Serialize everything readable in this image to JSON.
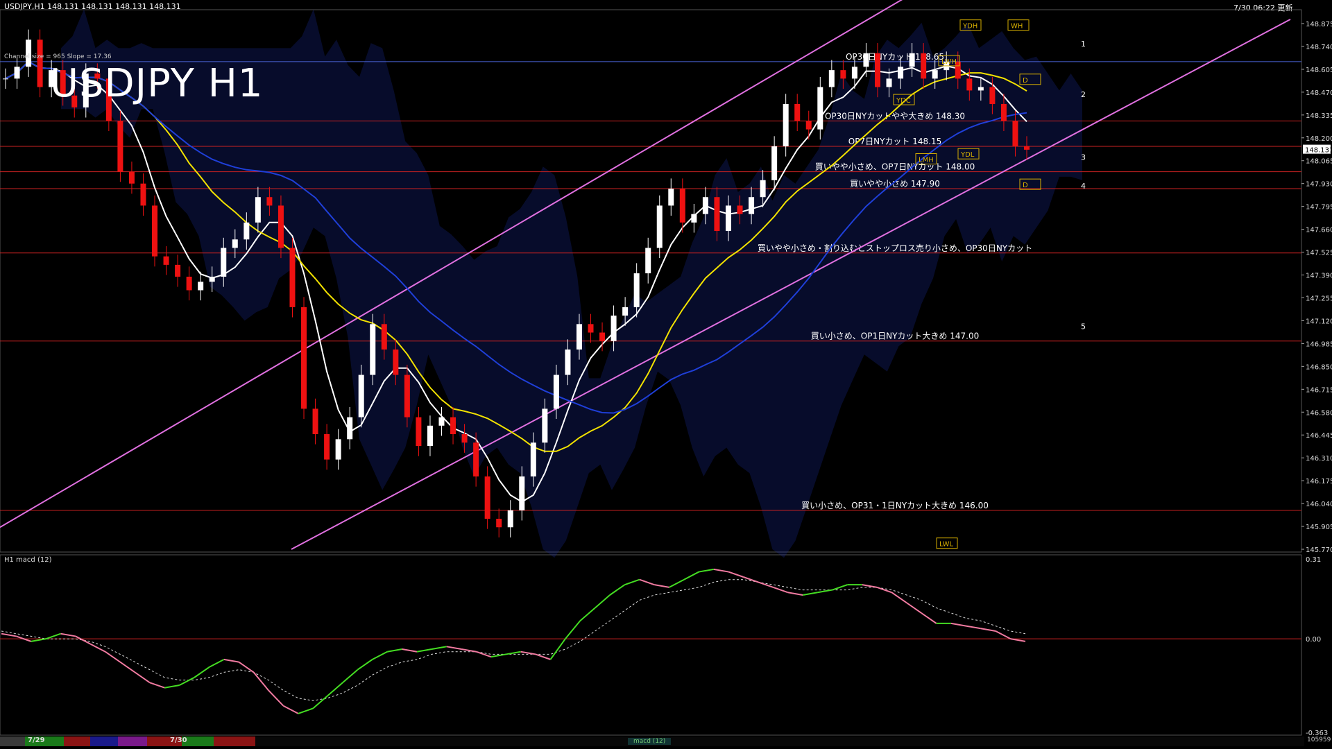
{
  "header": {
    "symbol_line": "USDJPY,H1  148.131 148.131 148.131 148.131",
    "timestamp": "7/30 06:22 更新",
    "big_title": "USDJPY H1",
    "channel_info": "Channel size = 965 Slope = 17.36"
  },
  "chart_data": {
    "type": "line",
    "price_axis": {
      "ticks": [
        "148.875",
        "148.740",
        "148.605",
        "148.470",
        "148.335",
        "148.200",
        "148.065",
        "147.930",
        "147.795",
        "147.660",
        "147.525",
        "147.390",
        "147.255",
        "147.120",
        "146.985",
        "146.850",
        "146.715",
        "146.580",
        "146.445",
        "146.310",
        "146.175",
        "146.040",
        "145.905",
        "145.770"
      ],
      "range": [
        145.77,
        148.875
      ],
      "current_price": "148.131"
    },
    "horizontal_levels": [
      {
        "price": 148.65,
        "label": "OP30日NYカット 148.65",
        "color": "#4a63d6"
      },
      {
        "price": 148.3,
        "label": "OP30日NYカットやや大きめ 148.30",
        "color": "#cc2222"
      },
      {
        "price": 148.15,
        "label": "OP7日NYカット 148.15",
        "color": "#cc2222"
      },
      {
        "price": 148.0,
        "label": "買いやや小さめ、OP7日NYカット 148.00",
        "color": "#cc2222"
      },
      {
        "price": 147.9,
        "label": "買いやや小さめ 147.90",
        "color": "#cc2222"
      },
      {
        "price": 147.52,
        "label": "買いやや小さめ・割り込むとストップロス売り小さめ、OP30日NYカット",
        "color": "#cc2222"
      },
      {
        "price": 147.0,
        "label": "買い小さめ、OP1日NYカット大きめ 147.00",
        "color": "#cc2222"
      },
      {
        "price": 146.0,
        "label": "買い小さめ、OP31・1日NYカット大きめ 146.00",
        "color": "#cc2222"
      }
    ],
    "pivot_labels": [
      {
        "label": "YDH",
        "price": 148.86
      },
      {
        "label": "WH",
        "price": 148.86
      },
      {
        "label": "LWH",
        "price": 148.65
      },
      {
        "label": "D",
        "price": 148.54
      },
      {
        "label": "YDC",
        "price": 148.42
      },
      {
        "label": "YDL",
        "price": 148.1
      },
      {
        "label": "LMH",
        "price": 148.07
      },
      {
        "label": "D",
        "price": 147.92
      },
      {
        "label": "LWL",
        "price": 145.8
      }
    ],
    "wave_labels": [
      "1",
      "2",
      "3",
      "4",
      "5"
    ],
    "date_labels": [
      "7/29",
      "7/30"
    ],
    "close_prices": [
      148.55,
      148.62,
      148.78,
      148.5,
      148.6,
      148.45,
      148.38,
      148.58,
      148.55,
      148.3,
      148.0,
      147.93,
      147.8,
      147.5,
      147.45,
      147.38,
      147.3,
      147.35,
      147.38,
      147.55,
      147.6,
      147.7,
      147.85,
      147.8,
      147.55,
      147.2,
      146.6,
      146.45,
      146.3,
      146.42,
      146.55,
      146.8,
      147.1,
      146.95,
      146.8,
      146.55,
      146.38,
      146.5,
      146.55,
      146.45,
      146.4,
      146.2,
      145.95,
      145.9,
      146.0,
      146.2,
      146.4,
      146.6,
      146.8,
      146.95,
      147.1,
      147.05,
      147.0,
      147.15,
      147.2,
      147.4,
      147.55,
      147.8,
      147.9,
      147.7,
      147.75,
      147.85,
      147.65,
      147.8,
      147.75,
      147.85,
      147.95,
      148.15,
      148.4,
      148.3,
      148.25,
      148.5,
      148.6,
      148.55,
      148.62,
      148.7,
      148.5,
      148.55,
      148.62,
      148.7,
      148.55,
      148.6,
      148.65,
      148.55,
      148.48,
      148.5,
      148.4,
      148.3,
      148.15,
      148.13
    ],
    "macd": {
      "name": "H1 macd (12)",
      "range": [
        -0.363,
        0.31
      ],
      "ticks": [
        "0.31",
        "0.00",
        "-0.363"
      ],
      "values": [
        0.02,
        0.01,
        -0.01,
        0.0,
        0.02,
        0.01,
        -0.02,
        -0.05,
        -0.09,
        -0.13,
        -0.17,
        -0.19,
        -0.18,
        -0.15,
        -0.11,
        -0.08,
        -0.09,
        -0.13,
        -0.2,
        -0.26,
        -0.29,
        -0.27,
        -0.22,
        -0.17,
        -0.12,
        -0.08,
        -0.05,
        -0.04,
        -0.05,
        -0.04,
        -0.03,
        -0.04,
        -0.05,
        -0.07,
        -0.06,
        -0.05,
        -0.06,
        -0.08,
        0.0,
        0.07,
        0.12,
        0.17,
        0.21,
        0.23,
        0.21,
        0.2,
        0.23,
        0.26,
        0.27,
        0.26,
        0.24,
        0.22,
        0.2,
        0.18,
        0.17,
        0.18,
        0.19,
        0.21,
        0.21,
        0.2,
        0.18,
        0.14,
        0.1,
        0.06,
        0.06,
        0.05,
        0.04,
        0.03,
        0.0,
        -0.01
      ],
      "signal": [
        0.03,
        0.02,
        0.01,
        0.0,
        0.0,
        0.0,
        -0.01,
        -0.03,
        -0.06,
        -0.09,
        -0.12,
        -0.15,
        -0.16,
        -0.16,
        -0.15,
        -0.13,
        -0.12,
        -0.13,
        -0.16,
        -0.2,
        -0.23,
        -0.24,
        -0.23,
        -0.21,
        -0.18,
        -0.14,
        -0.11,
        -0.09,
        -0.08,
        -0.06,
        -0.05,
        -0.05,
        -0.05,
        -0.06,
        -0.06,
        -0.06,
        -0.06,
        -0.06,
        -0.04,
        -0.01,
        0.03,
        0.07,
        0.11,
        0.15,
        0.17,
        0.18,
        0.19,
        0.2,
        0.22,
        0.23,
        0.23,
        0.22,
        0.21,
        0.2,
        0.19,
        0.19,
        0.19,
        0.19,
        0.2,
        0.2,
        0.19,
        0.17,
        0.15,
        0.12,
        0.1,
        0.08,
        0.07,
        0.05,
        0.03,
        0.02
      ]
    },
    "volume_label": "105959",
    "macd_tab": "macd (12)"
  },
  "colors": {
    "background": "#000000",
    "bull_candle": "#ffffff",
    "bear_candle": "#ee1111",
    "ma_white": "#ffffff",
    "ma_yellow": "#f2e200",
    "ma_blue": "#1f3fd8",
    "chikou": "#33c01f",
    "channel": "#e070e0",
    "level_red": "#cc2222",
    "bollinger": "#d01818",
    "cloud_blue": "#1a2a9c",
    "cloud_orange": "#8a4a1a"
  }
}
